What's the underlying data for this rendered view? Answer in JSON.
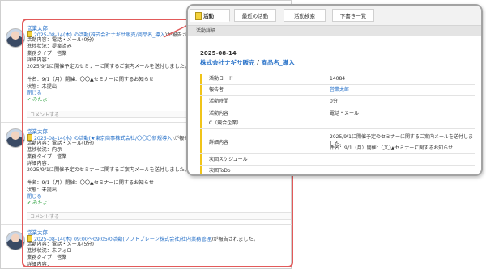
{
  "feed": {
    "posts": [
      {
        "author": "営業太郎",
        "headline_prefix": "2025-08-14(木) の活動(",
        "headline_link": "株式会社ナギサ販売/商品名_導入",
        "headline_suffix": ")が報告さ",
        "lines": [
          "活動内容：電話・メール(0分)",
          "進捗状況：提案済み",
          "業務タイプ：営業",
          "詳細内容：",
          "2025/9/1に開催予定のセミナーに関するご案内メールを送付しました。"
        ],
        "lines2": [
          "件名：9/1（月）開催：〇〇▲セミナーに関するお知らせ",
          "状態：未提出"
        ],
        "close": "閉じる",
        "like": "✔ みたよ！",
        "comment": "コメントする"
      },
      {
        "author": "営業太郎",
        "headline_prefix": "2025-08-14(木) の活動(",
        "headline_link": "★東京商事株式会社/〇〇〇新規導入",
        "headline_suffix": ")が報告さ",
        "lines": [
          "活動内容：電話・メール(0分)",
          "進捗状況：内示",
          "業務タイプ：営業",
          "詳細内容：",
          "2025/9/1に開催予定のセミナーに関するご案内メールを送付しました。"
        ],
        "lines2": [
          "件名：9/1（月）開催：〇〇▲セミナーに関するお知らせ",
          "状態：未提出"
        ],
        "close": "閉じる",
        "like": "✔ みたよ！",
        "comment": "コメントする"
      },
      {
        "author": "営業太郎",
        "headline_prefix": "2025-08-14(木) 09:00～09:05の活動(",
        "headline_link": "ソフトプレーン株式会社/社内業務管理",
        "headline_suffix": ")が報告されました。",
        "lines": [
          "活動内容：電話・メール(5分)",
          "進捗状況：未フォロー",
          "業務タイプ：営業",
          "詳細内容："
        ]
      }
    ]
  },
  "popup": {
    "tabs": [
      "活動",
      "最近の活動",
      "活動検索",
      "下書き一覧"
    ],
    "subtitle": "活動詳細",
    "date": "2025-08-14",
    "company": "株式会社ナギサ販売",
    "title_sep": " / ",
    "product": "商品名_導入",
    "rows": [
      {
        "label": "活動コード",
        "value": "14084"
      },
      {
        "label": "報告者",
        "value": "営業太郎",
        "link": true
      },
      {
        "label": "活動時間",
        "value": "0分"
      },
      {
        "label": "活動内容",
        "value": "電話・メール",
        "label2": "C（競合企業）"
      },
      {
        "label": "詳細内容",
        "value": "2025/9/1に開催予定のセミナーに関するご案内メールを送付しました。",
        "value2": "件名：9/1（月）開催：〇〇▲セミナーに関するお知らせ"
      },
      {
        "label": "次回スケジュール",
        "value": ""
      },
      {
        "label": "次回ToDo",
        "value": ""
      }
    ]
  },
  "colors": {
    "accent": "#2a73c9",
    "highlight_border": "#e25a5a",
    "activity_bar": "#f0c419"
  }
}
